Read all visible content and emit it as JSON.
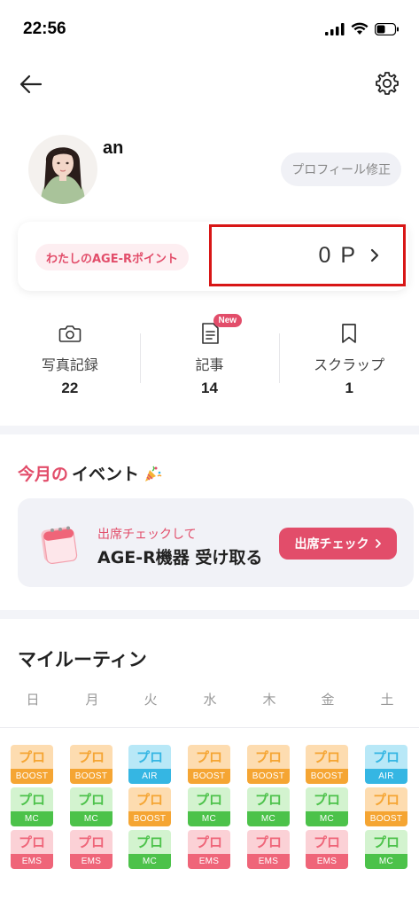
{
  "status": {
    "time": "22:56"
  },
  "profile": {
    "name": "an",
    "edit_label": "プロフィール修正"
  },
  "points": {
    "label": "わたしのAGE-Rポイント",
    "value": "0 P"
  },
  "stats": [
    {
      "label": "写真記録",
      "count": "22"
    },
    {
      "label": "記事",
      "count": "14",
      "badge": "New"
    },
    {
      "label": "スクラップ",
      "count": "1"
    }
  ],
  "events": {
    "title_accent": "今月の",
    "title": "イベント",
    "subtitle": "出席チェックして",
    "headline": "AGE-R機器 受け取る",
    "button": "出席チェック"
  },
  "routine": {
    "title": "マイルーティン",
    "weekdays": [
      "日",
      "月",
      "火",
      "水",
      "木",
      "金",
      "土"
    ],
    "chip_top_label": "プロ",
    "rows": [
      [
        "BOOST",
        "BOOST",
        "AIR",
        "BOOST",
        "BOOST",
        "BOOST",
        "AIR"
      ],
      [
        "MC",
        "MC",
        "BOOST",
        "MC",
        "MC",
        "MC",
        "BOOST"
      ],
      [
        "EMS",
        "EMS",
        "MC",
        "EMS",
        "EMS",
        "EMS",
        "MC"
      ]
    ]
  },
  "colors": {
    "accent": "#e24d6a",
    "highlight_box": "#d81616",
    "boost_top": "#fddcb0",
    "boost_bottom": "#f5a533",
    "air_top": "#b8e8f7",
    "air_bottom": "#35b6e3",
    "mc_top": "#d3f3cf",
    "mc_bottom": "#4cc24a",
    "ems_top": "#fbd1d6",
    "ems_bottom": "#ef6579"
  }
}
